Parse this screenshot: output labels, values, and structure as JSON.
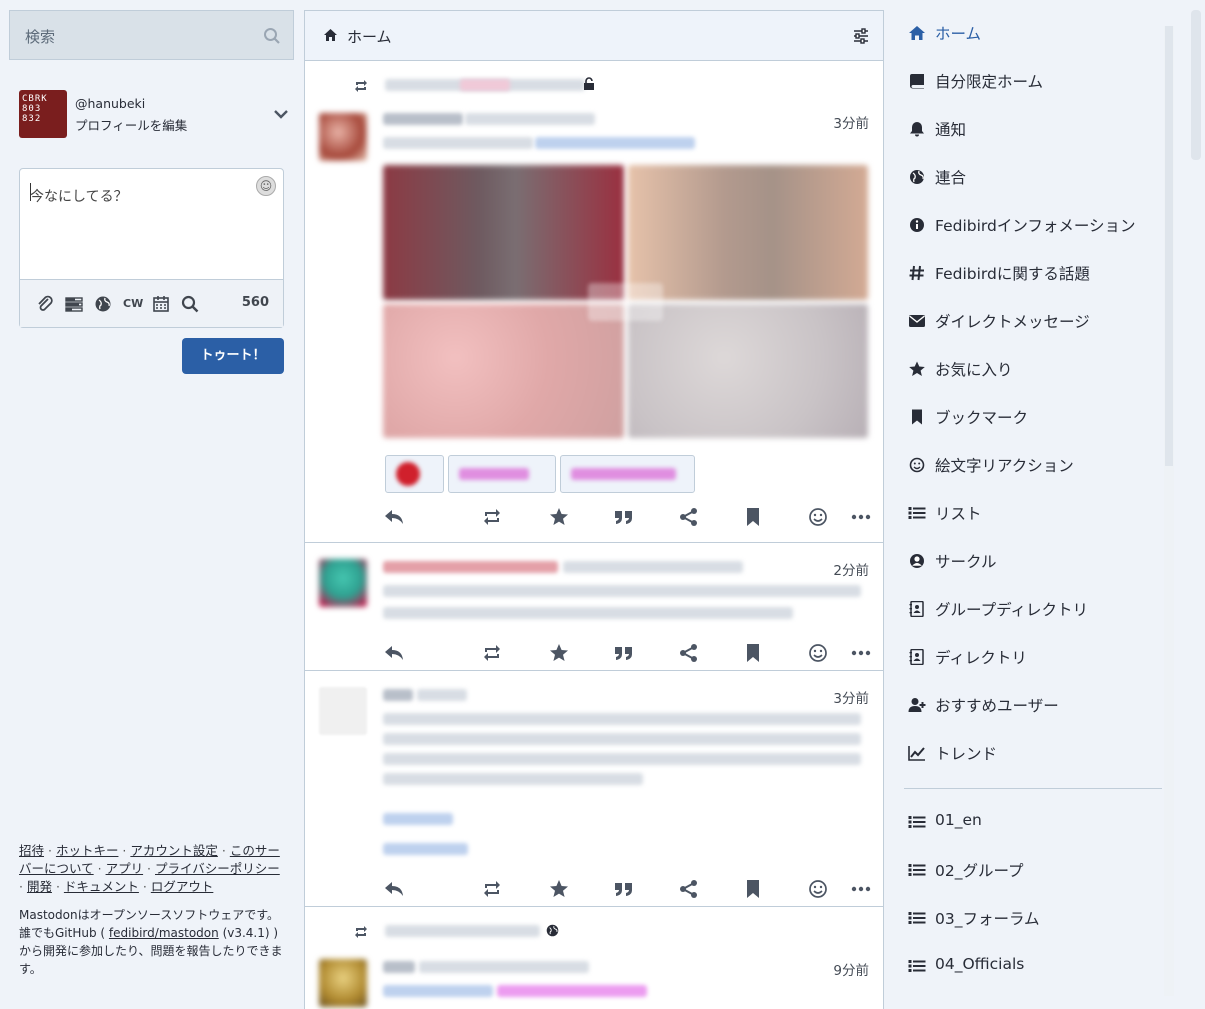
{
  "search": {
    "placeholder": "検索"
  },
  "account": {
    "avatar_text": "CBRK\n803\n832",
    "handle": "@hanubeki",
    "edit_profile": "プロフィールを編集"
  },
  "composer": {
    "placeholder": "今なにしてる？",
    "cw_label": "CW",
    "char_count": "560",
    "toot_button": "トゥート！"
  },
  "footer": {
    "links": [
      "招待",
      "ホットキー",
      "アカウント設定",
      "このサーバーについて",
      "アプリ",
      "プライバシーポリシー",
      "開発",
      "ドキュメント",
      "ログアウト"
    ],
    "about_prefix": "Mastodonはオープンソースソフトウェアです。誰でもGitHub (",
    "about_repo": "fedibird/mastodon",
    "about_suffix": "(v3.4.1) ) から開発に参加したり、問題を報告したりできます。"
  },
  "timeline": {
    "title": "ホーム",
    "statuses": [
      {
        "time": "3分前"
      },
      {
        "time": "2分前"
      },
      {
        "time": "3分前"
      },
      {
        "time": "9分前"
      }
    ]
  },
  "nav": {
    "items": [
      {
        "label": "ホーム",
        "icon": "home-icon"
      },
      {
        "label": "自分限定ホーム",
        "icon": "book-icon"
      },
      {
        "label": "通知",
        "icon": "bell-icon"
      },
      {
        "label": "連合",
        "icon": "globe-icon"
      },
      {
        "label": "Fedibirdインフォメーション",
        "icon": "info-icon"
      },
      {
        "label": "Fedibirdに関する話題",
        "icon": "hashtag-icon"
      },
      {
        "label": "ダイレクトメッセージ",
        "icon": "envelope-icon"
      },
      {
        "label": "お気に入り",
        "icon": "star-icon"
      },
      {
        "label": "ブックマーク",
        "icon": "bookmark-icon"
      },
      {
        "label": "絵文字リアクション",
        "icon": "smile-icon"
      },
      {
        "label": "リスト",
        "icon": "list-icon"
      },
      {
        "label": "サークル",
        "icon": "user-circle-icon"
      },
      {
        "label": "グループディレクトリ",
        "icon": "address-book-icon"
      },
      {
        "label": "ディレクトリ",
        "icon": "address-book-icon"
      },
      {
        "label": "おすすめユーザー",
        "icon": "user-plus-icon"
      },
      {
        "label": "トレンド",
        "icon": "chart-line-icon"
      }
    ],
    "lists": [
      {
        "label": "01_en",
        "icon": "list-icon"
      },
      {
        "label": "02_グループ",
        "icon": "list-icon"
      },
      {
        "label": "03_フォーラム",
        "icon": "list-icon"
      },
      {
        "label": "04_Officials",
        "icon": "list-icon"
      }
    ]
  },
  "colors": {
    "accent": "#2b5fa6",
    "background": "#eff3f9",
    "border": "#c0cdd9"
  }
}
